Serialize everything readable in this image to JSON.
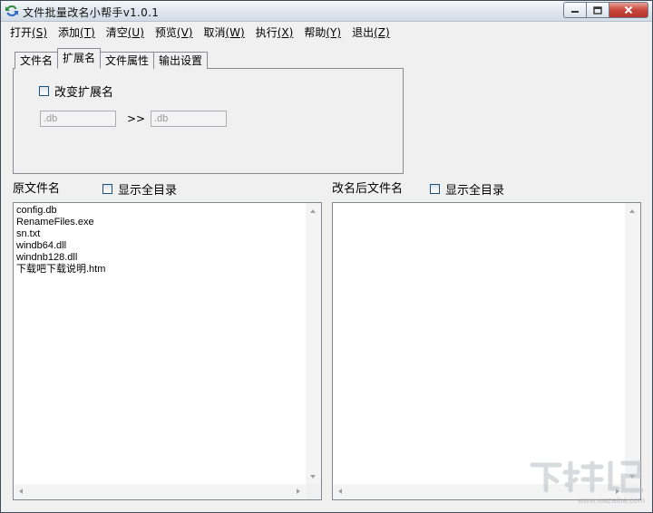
{
  "window": {
    "title": "文件批量改名小帮手v1.0.1"
  },
  "menu": [
    {
      "label": "打开",
      "key": "(S)"
    },
    {
      "label": "添加",
      "key": "(T)"
    },
    {
      "label": "清空",
      "key": "(U)"
    },
    {
      "label": "预览",
      "key": "(V)"
    },
    {
      "label": "取消",
      "key": "(W)"
    },
    {
      "label": "执行",
      "key": "(X)"
    },
    {
      "label": "帮助",
      "key": "(Y)"
    },
    {
      "label": "退出",
      "key": "(Z)"
    }
  ],
  "tabs": {
    "items": [
      "文件名",
      "扩展名",
      "文件属性",
      "输出设置"
    ],
    "active": "扩展名"
  },
  "extension_panel": {
    "change_ext_label": "改变扩展名",
    "from_placeholder": ".db",
    "arrow": ">>",
    "to_placeholder": ".db"
  },
  "original": {
    "label": "原文件名",
    "show_full_dir_label": "显示全目录",
    "files": [
      "config.db",
      "RenameFiles.exe",
      "sn.txt",
      "windb64.dll",
      "windnb128.dll",
      "下载吧下载说明.htm"
    ]
  },
  "renamed": {
    "label": "改名后文件名",
    "show_full_dir_label": "显示全目录",
    "files": []
  },
  "watermark": {
    "text": "www.xiazaiba.com"
  },
  "colors": {
    "desktop": "#6f8aa8",
    "window_bg": "#f0f0f0",
    "close_button": "#c9463d"
  }
}
